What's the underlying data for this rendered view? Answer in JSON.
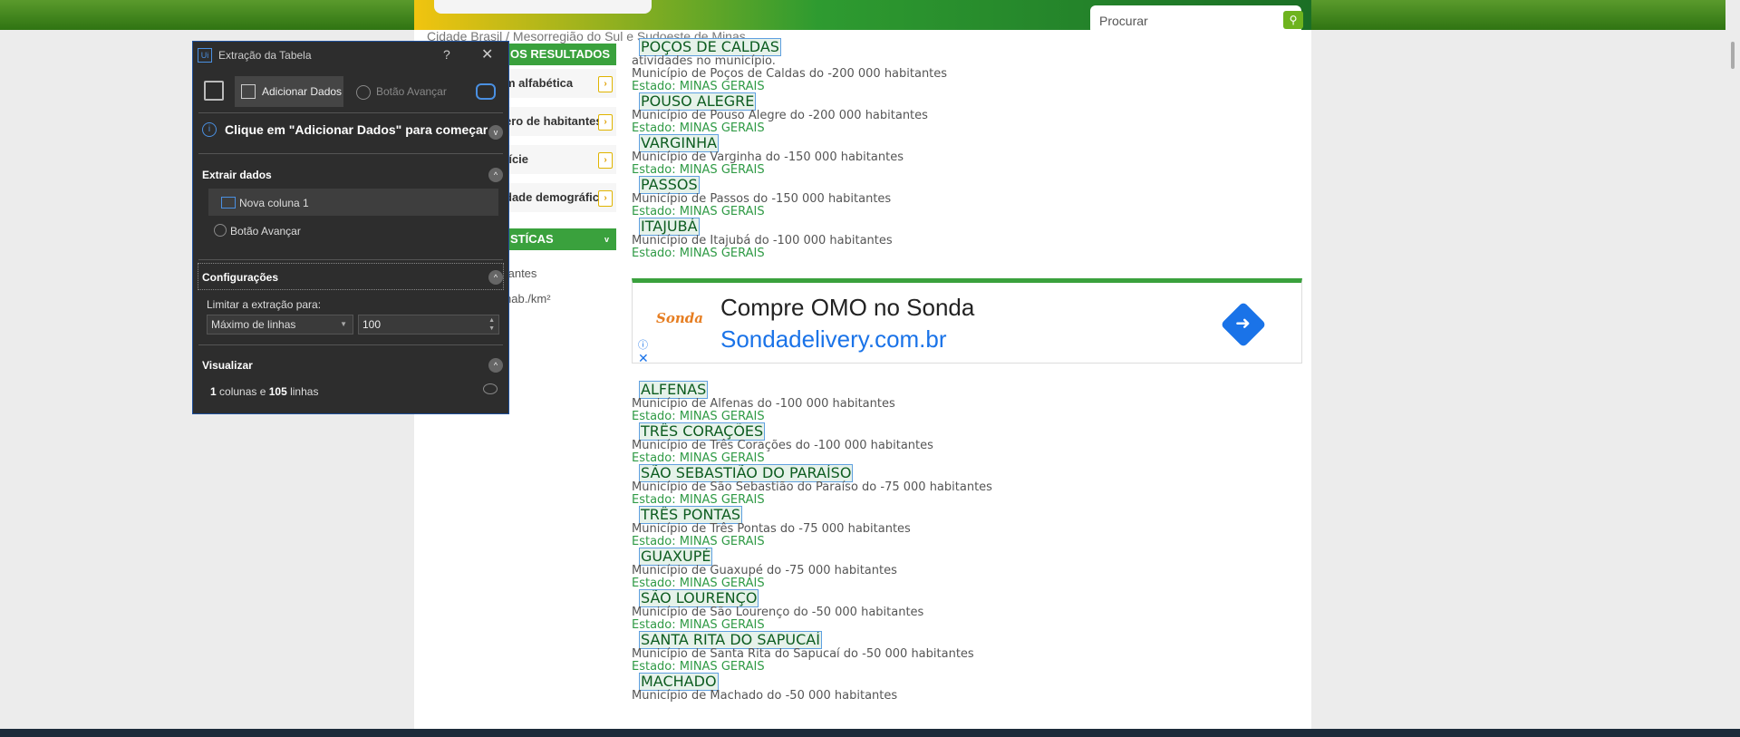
{
  "search": {
    "placeholder": "Procurar"
  },
  "breadcrumb": "Cidade Brasil / Mesorregião do Sul e Sudoeste de Minas",
  "sidebar": {
    "results_heading": "OS RESULTADOS",
    "items": [
      {
        "label": "m alfabética"
      },
      {
        "label": "ero de habitantes"
      },
      {
        "label": "fície"
      },
      {
        "label": "dade demográfica"
      }
    ],
    "stats_heading": "STÍCAS",
    "stats_lines": [
      "tantes",
      "²",
      "hab./km²"
    ]
  },
  "results": {
    "top_snippet": "atividades no município.",
    "cities_before_ad": [
      {
        "name": "POÇOS DE CALDAS",
        "desc": "Município de Poços de Caldas do -200 000 habitantes",
        "state": "Estado: MINAS GERAIS"
      },
      {
        "name": "POUSO ALEGRE",
        "desc": "Município de Pouso Alegre do -200 000 habitantes",
        "state": "Estado: MINAS GERAIS"
      },
      {
        "name": "VARGINHA",
        "desc": "Município de Varginha do -150 000 habitantes",
        "state": "Estado: MINAS GERAIS"
      },
      {
        "name": "PASSOS",
        "desc": "Município de Passos do -150 000 habitantes",
        "state": "Estado: MINAS GERAIS"
      },
      {
        "name": "ITAJUBÁ",
        "desc": "Município de Itajubá do -100 000 habitantes",
        "state": "Estado: MINAS GERAIS"
      }
    ],
    "cities_after_ad": [
      {
        "name": "ALFENAS",
        "desc": "Município de Alfenas do -100 000 habitantes",
        "state": "Estado: MINAS GERAIS"
      },
      {
        "name": "TRÊS CORAÇÕES",
        "desc": "Município de Três Corações do -100 000 habitantes",
        "state": "Estado: MINAS GERAIS"
      },
      {
        "name": "SÃO SEBASTIÃO DO PARAÍSO",
        "desc": "Município de São Sebastião do Paraíso do -75 000 habitantes",
        "state": "Estado: MINAS GERAIS"
      },
      {
        "name": "TRÊS PONTAS",
        "desc": "Município de Três Pontas do -75 000 habitantes",
        "state": "Estado: MINAS GERAIS"
      },
      {
        "name": "GUAXUPÉ",
        "desc": "Município de Guaxupé do -75 000 habitantes",
        "state": "Estado: MINAS GERAIS"
      },
      {
        "name": "SÃO LOURENÇO",
        "desc": "Município de São Lourenço do -50 000 habitantes",
        "state": "Estado: MINAS GERAIS"
      },
      {
        "name": "SANTA RITA DO SAPUCAÍ",
        "desc": "Município de Santa Rita do Sapucaí do -50 000 habitantes",
        "state": "Estado: MINAS GERAIS"
      },
      {
        "name": "MACHADO",
        "desc": "Município de Machado do -50 000 habitantes",
        "state": ""
      }
    ]
  },
  "ad": {
    "logo": "Sonda",
    "title": "Compre OMO no Sonda",
    "url": "Sondadelivery.com.br"
  },
  "dialog": {
    "title": "Extração da Tabela",
    "help": "?",
    "close": "✕",
    "add_data": "Adicionar Dados",
    "next_button": "Botão Avançar",
    "hint": "Clique em \"Adicionar Dados\" para começar",
    "extract_heading": "Extrair dados",
    "column_item": "Nova coluna 1",
    "next_item": "Botão Avançar",
    "config_heading": "Configurações",
    "limit_label": "Limitar a extração para:",
    "limit_select": "Máximo de linhas",
    "limit_value": "100",
    "preview_heading": "Visualizar",
    "preview_columns": "1",
    "preview_columns_text": " colunas e ",
    "preview_rows": "105",
    "preview_rows_text": " linhas"
  },
  "colors": {
    "accent_green": "#3aa13d",
    "link_blue": "#1a73e8",
    "dialog_bg": "#2d2d2d"
  }
}
